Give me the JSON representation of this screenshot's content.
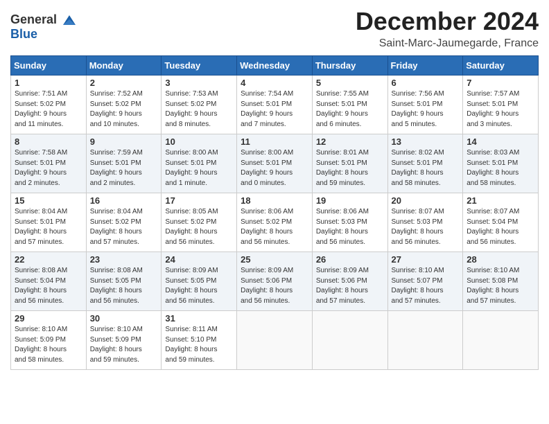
{
  "header": {
    "logo_line1": "General",
    "logo_line2": "Blue",
    "title": "December 2024",
    "subtitle": "Saint-Marc-Jaumegarde, France"
  },
  "weekdays": [
    "Sunday",
    "Monday",
    "Tuesday",
    "Wednesday",
    "Thursday",
    "Friday",
    "Saturday"
  ],
  "weeks": [
    [
      {
        "day": "1",
        "lines": [
          "Sunrise: 7:51 AM",
          "Sunset: 5:02 PM",
          "Daylight: 9 hours",
          "and 11 minutes."
        ]
      },
      {
        "day": "2",
        "lines": [
          "Sunrise: 7:52 AM",
          "Sunset: 5:02 PM",
          "Daylight: 9 hours",
          "and 10 minutes."
        ]
      },
      {
        "day": "3",
        "lines": [
          "Sunrise: 7:53 AM",
          "Sunset: 5:02 PM",
          "Daylight: 9 hours",
          "and 8 minutes."
        ]
      },
      {
        "day": "4",
        "lines": [
          "Sunrise: 7:54 AM",
          "Sunset: 5:01 PM",
          "Daylight: 9 hours",
          "and 7 minutes."
        ]
      },
      {
        "day": "5",
        "lines": [
          "Sunrise: 7:55 AM",
          "Sunset: 5:01 PM",
          "Daylight: 9 hours",
          "and 6 minutes."
        ]
      },
      {
        "day": "6",
        "lines": [
          "Sunrise: 7:56 AM",
          "Sunset: 5:01 PM",
          "Daylight: 9 hours",
          "and 5 minutes."
        ]
      },
      {
        "day": "7",
        "lines": [
          "Sunrise: 7:57 AM",
          "Sunset: 5:01 PM",
          "Daylight: 9 hours",
          "and 3 minutes."
        ]
      }
    ],
    [
      {
        "day": "8",
        "lines": [
          "Sunrise: 7:58 AM",
          "Sunset: 5:01 PM",
          "Daylight: 9 hours",
          "and 2 minutes."
        ]
      },
      {
        "day": "9",
        "lines": [
          "Sunrise: 7:59 AM",
          "Sunset: 5:01 PM",
          "Daylight: 9 hours",
          "and 2 minutes."
        ]
      },
      {
        "day": "10",
        "lines": [
          "Sunrise: 8:00 AM",
          "Sunset: 5:01 PM",
          "Daylight: 9 hours",
          "and 1 minute."
        ]
      },
      {
        "day": "11",
        "lines": [
          "Sunrise: 8:00 AM",
          "Sunset: 5:01 PM",
          "Daylight: 9 hours",
          "and 0 minutes."
        ]
      },
      {
        "day": "12",
        "lines": [
          "Sunrise: 8:01 AM",
          "Sunset: 5:01 PM",
          "Daylight: 8 hours",
          "and 59 minutes."
        ]
      },
      {
        "day": "13",
        "lines": [
          "Sunrise: 8:02 AM",
          "Sunset: 5:01 PM",
          "Daylight: 8 hours",
          "and 58 minutes."
        ]
      },
      {
        "day": "14",
        "lines": [
          "Sunrise: 8:03 AM",
          "Sunset: 5:01 PM",
          "Daylight: 8 hours",
          "and 58 minutes."
        ]
      }
    ],
    [
      {
        "day": "15",
        "lines": [
          "Sunrise: 8:04 AM",
          "Sunset: 5:01 PM",
          "Daylight: 8 hours",
          "and 57 minutes."
        ]
      },
      {
        "day": "16",
        "lines": [
          "Sunrise: 8:04 AM",
          "Sunset: 5:02 PM",
          "Daylight: 8 hours",
          "and 57 minutes."
        ]
      },
      {
        "day": "17",
        "lines": [
          "Sunrise: 8:05 AM",
          "Sunset: 5:02 PM",
          "Daylight: 8 hours",
          "and 56 minutes."
        ]
      },
      {
        "day": "18",
        "lines": [
          "Sunrise: 8:06 AM",
          "Sunset: 5:02 PM",
          "Daylight: 8 hours",
          "and 56 minutes."
        ]
      },
      {
        "day": "19",
        "lines": [
          "Sunrise: 8:06 AM",
          "Sunset: 5:03 PM",
          "Daylight: 8 hours",
          "and 56 minutes."
        ]
      },
      {
        "day": "20",
        "lines": [
          "Sunrise: 8:07 AM",
          "Sunset: 5:03 PM",
          "Daylight: 8 hours",
          "and 56 minutes."
        ]
      },
      {
        "day": "21",
        "lines": [
          "Sunrise: 8:07 AM",
          "Sunset: 5:04 PM",
          "Daylight: 8 hours",
          "and 56 minutes."
        ]
      }
    ],
    [
      {
        "day": "22",
        "lines": [
          "Sunrise: 8:08 AM",
          "Sunset: 5:04 PM",
          "Daylight: 8 hours",
          "and 56 minutes."
        ]
      },
      {
        "day": "23",
        "lines": [
          "Sunrise: 8:08 AM",
          "Sunset: 5:05 PM",
          "Daylight: 8 hours",
          "and 56 minutes."
        ]
      },
      {
        "day": "24",
        "lines": [
          "Sunrise: 8:09 AM",
          "Sunset: 5:05 PM",
          "Daylight: 8 hours",
          "and 56 minutes."
        ]
      },
      {
        "day": "25",
        "lines": [
          "Sunrise: 8:09 AM",
          "Sunset: 5:06 PM",
          "Daylight: 8 hours",
          "and 56 minutes."
        ]
      },
      {
        "day": "26",
        "lines": [
          "Sunrise: 8:09 AM",
          "Sunset: 5:06 PM",
          "Daylight: 8 hours",
          "and 57 minutes."
        ]
      },
      {
        "day": "27",
        "lines": [
          "Sunrise: 8:10 AM",
          "Sunset: 5:07 PM",
          "Daylight: 8 hours",
          "and 57 minutes."
        ]
      },
      {
        "day": "28",
        "lines": [
          "Sunrise: 8:10 AM",
          "Sunset: 5:08 PM",
          "Daylight: 8 hours",
          "and 57 minutes."
        ]
      }
    ],
    [
      {
        "day": "29",
        "lines": [
          "Sunrise: 8:10 AM",
          "Sunset: 5:09 PM",
          "Daylight: 8 hours",
          "and 58 minutes."
        ]
      },
      {
        "day": "30",
        "lines": [
          "Sunrise: 8:10 AM",
          "Sunset: 5:09 PM",
          "Daylight: 8 hours",
          "and 59 minutes."
        ]
      },
      {
        "day": "31",
        "lines": [
          "Sunrise: 8:11 AM",
          "Sunset: 5:10 PM",
          "Daylight: 8 hours",
          "and 59 minutes."
        ]
      },
      {
        "day": "",
        "lines": []
      },
      {
        "day": "",
        "lines": []
      },
      {
        "day": "",
        "lines": []
      },
      {
        "day": "",
        "lines": []
      }
    ]
  ]
}
